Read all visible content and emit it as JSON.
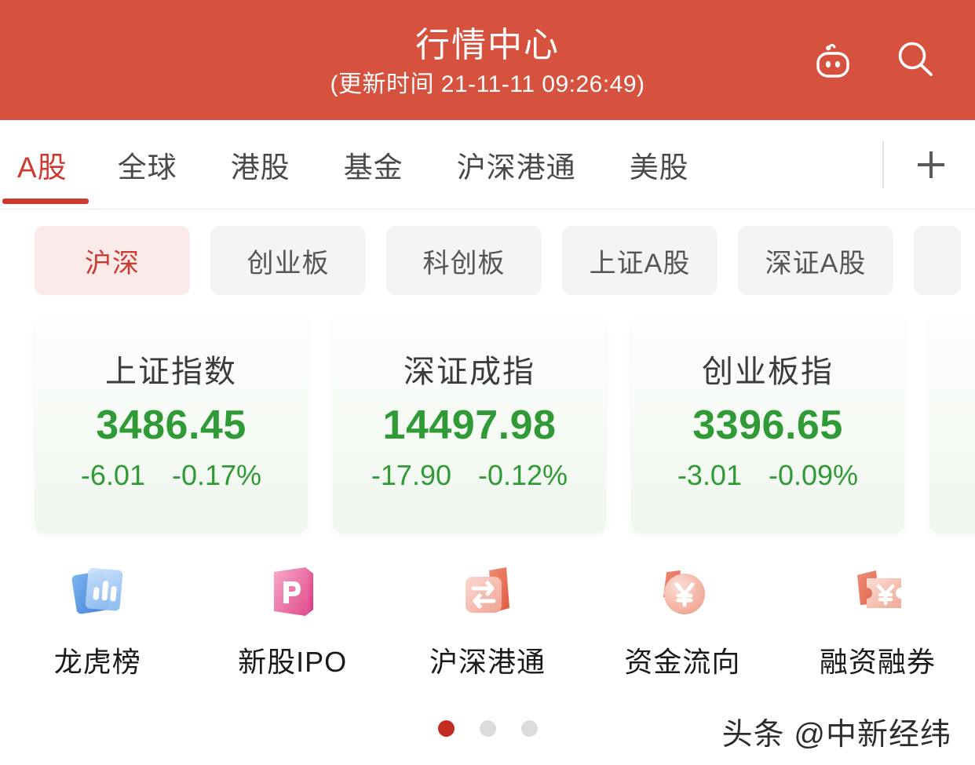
{
  "header": {
    "title": "行情中心",
    "subtitle": "(更新时间 21-11-11 09:26:49)",
    "background_color": "#d7513f",
    "robot_icon": "robot-assistant-icon",
    "search_icon": "search-icon"
  },
  "tabs": {
    "items": [
      {
        "label": "A股",
        "active": true
      },
      {
        "label": "全球",
        "active": false
      },
      {
        "label": "港股",
        "active": false
      },
      {
        "label": "基金",
        "active": false
      },
      {
        "label": "沪深港通",
        "active": false
      },
      {
        "label": "美股",
        "active": false
      }
    ],
    "add_label": "+",
    "active_color": "#cc3a30"
  },
  "chips": {
    "items": [
      {
        "label": "沪深",
        "active": true
      },
      {
        "label": "创业板",
        "active": false
      },
      {
        "label": "科创板",
        "active": false
      },
      {
        "label": "上证A股",
        "active": false
      },
      {
        "label": "深证A股",
        "active": false
      },
      {
        "label": "",
        "active": false
      }
    ],
    "active_bg": "#fbeaea",
    "active_color": "#cc3a30"
  },
  "index_cards": {
    "down_color": "#309b36",
    "items": [
      {
        "name": "上证指数",
        "value": "3486.45",
        "change": "-6.01",
        "change_percent": "-0.17%",
        "direction": "down"
      },
      {
        "name": "深证成指",
        "value": "14497.98",
        "change": "-17.90",
        "change_percent": "-0.12%",
        "direction": "down"
      },
      {
        "name": "创业板指",
        "value": "3396.65",
        "change": "-3.01",
        "change_percent": "-0.09%",
        "direction": "down"
      }
    ]
  },
  "quick_entries": {
    "items": [
      {
        "label": "龙虎榜",
        "icon": "cards-bar-chart-icon"
      },
      {
        "label": "新股IPO",
        "icon": "ipo-p-letter-icon"
      },
      {
        "label": "沪深港通",
        "icon": "folder-exchange-arrows-icon"
      },
      {
        "label": "资金流向",
        "icon": "yuan-coin-icon"
      },
      {
        "label": "融资融券",
        "icon": "yuan-ticket-icon"
      }
    ]
  },
  "pager": {
    "total": 3,
    "active_index": 0,
    "active_color": "#c42b22"
  },
  "watermark": {
    "text": "头条 @中新经纬"
  }
}
